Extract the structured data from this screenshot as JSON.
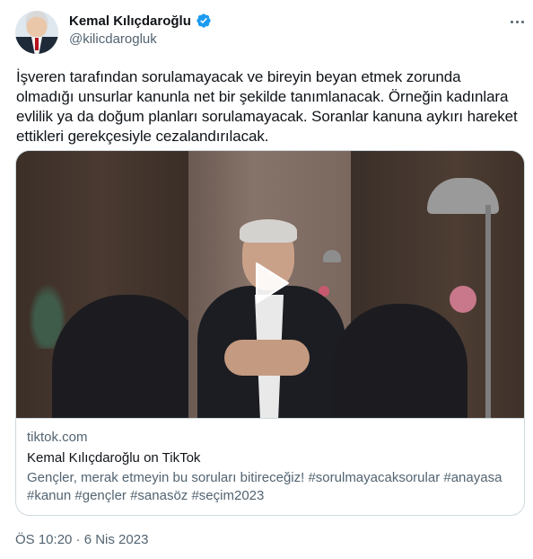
{
  "author": {
    "name": "Kemal Kılıçdaroğlu",
    "handle": "@kilicdarogluk",
    "verified_icon": "verified-badge-icon",
    "verified_color": "#1d9bf0"
  },
  "tweet": {
    "text": "İşveren tarafından sorulamayacak ve bireyin beyan etmek zorunda olmadığı unsurlar kanunla net bir şekilde tanımlanacak. Örneğin kadınlara evlilik ya da doğum planları sorulamayacak. Soranlar kanuna aykırı hareket ettikleri gerekçesiyle cezalandırılacak.",
    "timestamp": "ÖS 10:20 · 6 Nis 2023"
  },
  "card": {
    "domain": "tiktok.com",
    "title": "Kemal Kılıçdaroğlu on TikTok",
    "description": "Gençler, merak etmeyin bu soruları bitireceğiz! #sorulmayacaksorular #anayasa #kanun #gençler #sanasöz #seçim2023",
    "play_icon": "play-icon"
  },
  "colors": {
    "text_primary": "#0f1419",
    "text_secondary": "#536471",
    "border": "#cfd9de"
  }
}
